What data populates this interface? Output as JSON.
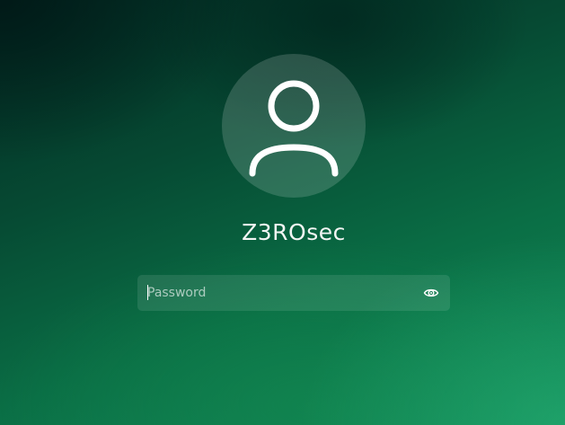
{
  "login": {
    "username": "Z3ROsec",
    "password": {
      "placeholder": "Password",
      "value": ""
    },
    "avatar_icon": "user-silhouette-icon",
    "reveal_icon": "eye-icon"
  },
  "colors": {
    "background_dark": "#022a22",
    "background_light": "#128a58",
    "text": "#f2f5f3"
  }
}
